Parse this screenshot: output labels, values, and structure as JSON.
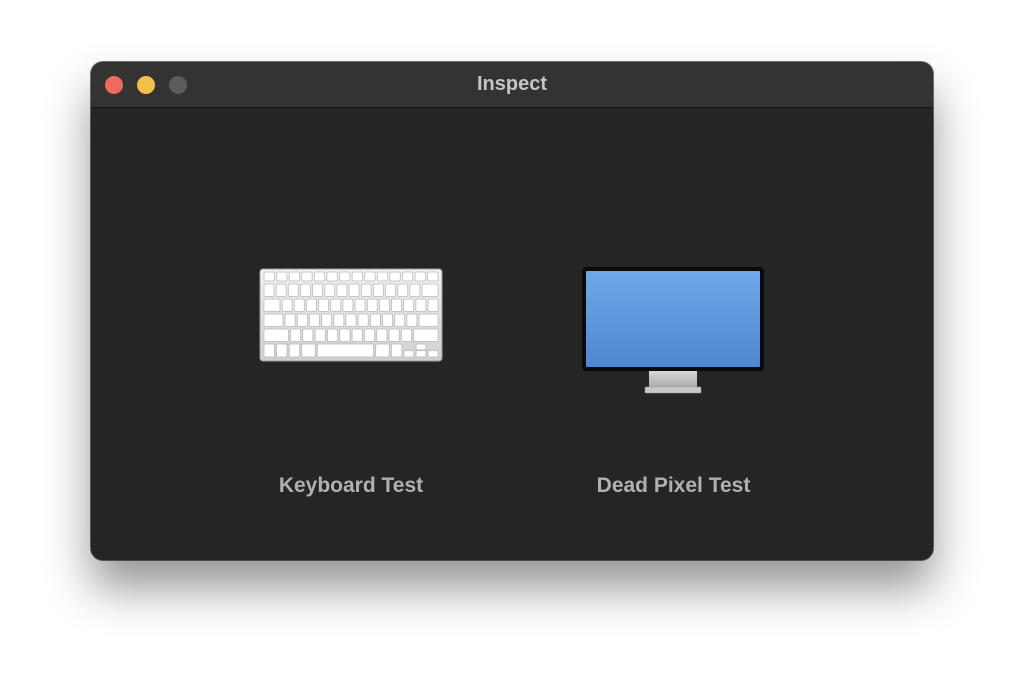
{
  "window": {
    "title": "Inspect",
    "traffic_lights": {
      "close": "#ec6a5e",
      "minimize": "#f4be4f",
      "zoom": "#5c5c5b"
    }
  },
  "tests": {
    "keyboard": {
      "label": "Keyboard Test",
      "icon": "keyboard-icon"
    },
    "dead_pixel": {
      "label": "Dead Pixel Test",
      "icon": "monitor-icon"
    }
  },
  "colors": {
    "window_bg": "#252624",
    "titlebar_bg": "#333332",
    "screen_blue": "#5d94dc",
    "label_text": "#b0b0b0"
  }
}
